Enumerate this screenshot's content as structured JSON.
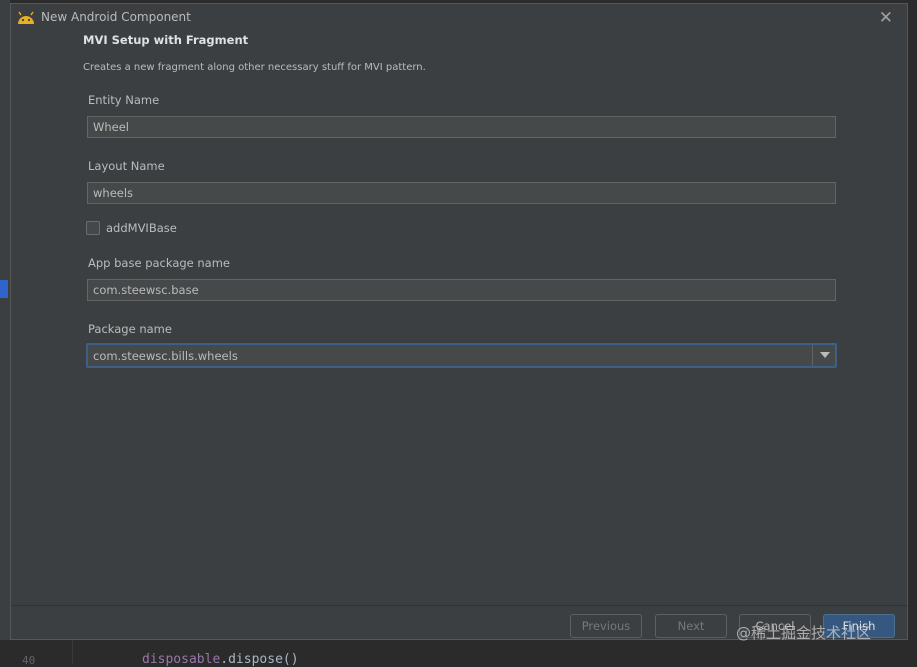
{
  "window": {
    "title": "New Android Component",
    "icon": "android-icon",
    "close_icon": "close-icon"
  },
  "page": {
    "heading": "MVI Setup with Fragment",
    "description": "Creates a new fragment along other necessary stuff for MVI pattern."
  },
  "fields": {
    "entity_name": {
      "label": "Entity Name",
      "value": "Wheel"
    },
    "layout_name": {
      "label": "Layout Name",
      "value": "wheels"
    },
    "add_mvi_base": {
      "label": "addMVIBase",
      "checked": false
    },
    "app_base_package": {
      "label": "App base package name",
      "value": "com.steewsc.base"
    },
    "package_name": {
      "label": "Package name",
      "value": "com.steewsc.bills.wheels"
    }
  },
  "buttons": {
    "previous": "Previous",
    "next": "Next",
    "cancel": "Cancel",
    "finish": "Finish"
  },
  "background_editor": {
    "line_number": "40",
    "code_keyword": "disposable",
    "code_rest": ".dispose()"
  },
  "watermark": "@稀土掘金技术社区",
  "colors": {
    "dialog_bg": "#3c3f41",
    "input_bg": "#45494a",
    "focus_border": "#3d6185",
    "default_button": "#365880",
    "android_green": "#a4c639"
  }
}
